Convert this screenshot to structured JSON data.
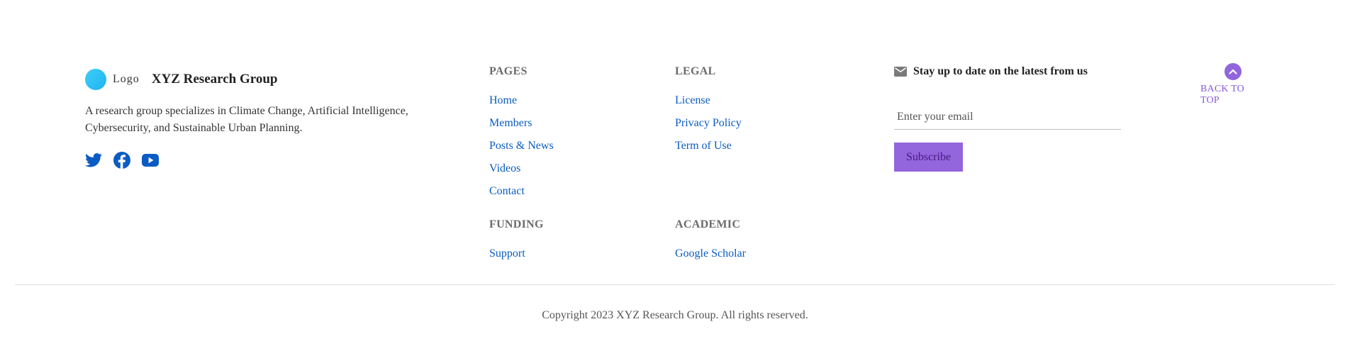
{
  "brand": {
    "logo_text": "Logo",
    "name": "XYZ Research Group",
    "description": "A research group specializes in Climate Change, Artificial Intelligence, Cybersecurity, and Sustainable Urban Planning.",
    "logo_color": "#1fb2f5",
    "socials": [
      {
        "icon": "twitter-icon",
        "color": "#0a5cc2"
      },
      {
        "icon": "facebook-icon",
        "color": "#0a5cc2"
      },
      {
        "icon": "youtube-icon",
        "color": "#0a5cc2"
      }
    ]
  },
  "pages": {
    "title": "PAGES",
    "links": [
      "Home",
      "Members",
      "Posts & News",
      "Videos",
      "Contact"
    ]
  },
  "legal": {
    "title": "LEGAL",
    "links": [
      "License",
      "Privacy Policy",
      "Term of Use"
    ]
  },
  "funding": {
    "title": "FUNDING",
    "links": [
      "Support"
    ]
  },
  "academic": {
    "title": "ACADEMIC",
    "links": [
      "Google Scholar"
    ]
  },
  "newsletter": {
    "icon": "mail-icon",
    "title": "Stay up to date on the latest from us",
    "email_placeholder": "Enter your email",
    "email_value": "",
    "subscribe_label": "Subscribe",
    "button_color": "#9366de"
  },
  "back_to_top": {
    "icon": "chevron-up-icon",
    "label": "BACK TO TOP",
    "color": "#8a5bd8"
  },
  "copyright": "Copyright 2023 XYZ Research Group. All rights reserved."
}
